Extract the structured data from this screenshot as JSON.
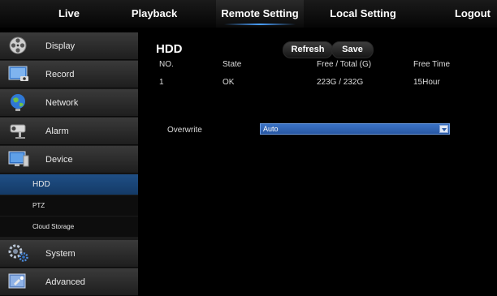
{
  "topnav": {
    "tabs": [
      "Live",
      "Playback",
      "Remote Setting",
      "Local Setting",
      "Logout"
    ],
    "active_tab": "Remote Setting"
  },
  "sidebar": {
    "items": [
      {
        "label": "Display",
        "icon": "film-reel-icon"
      },
      {
        "label": "Record",
        "icon": "camera-monitor-icon"
      },
      {
        "label": "Network",
        "icon": "globe-icon"
      },
      {
        "label": "Alarm",
        "icon": "cctv-camera-icon"
      },
      {
        "label": "Device",
        "icon": "computer-monitor-icon"
      },
      {
        "label": "System",
        "icon": "gears-icon"
      },
      {
        "label": "Advanced",
        "icon": "advanced-settings-icon"
      }
    ],
    "sub_items": [
      "HDD",
      "PTZ",
      "Cloud Storage"
    ],
    "active_sub_item": "HDD"
  },
  "hdd": {
    "title": "HDD",
    "refresh_label": "Refresh",
    "save_label": "Save",
    "columns": [
      "NO.",
      "State",
      "Free / Total (G)",
      "Free Time"
    ],
    "rows": [
      {
        "no": "1",
        "state": "OK",
        "free_total": "223G / 232G",
        "free_time": "15Hour"
      }
    ],
    "overwrite_label": "Overwrite",
    "overwrite_value": "Auto"
  },
  "colors": {
    "active_blue": "#1f4f86",
    "select_blue": "#2f63b0",
    "background": "#000000"
  }
}
